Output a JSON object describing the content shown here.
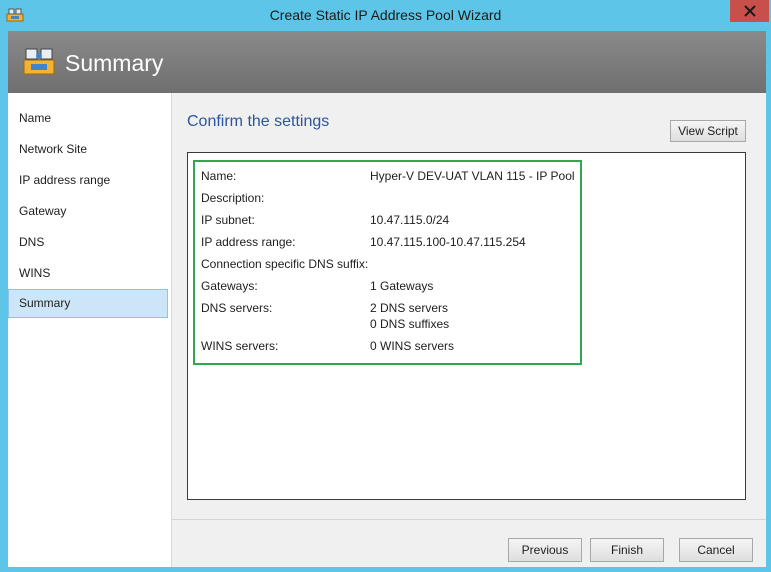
{
  "window": {
    "title": "Create Static IP Address Pool Wizard"
  },
  "header": {
    "title": "Summary"
  },
  "nav": {
    "items": [
      {
        "label": "Name"
      },
      {
        "label": "Network Site"
      },
      {
        "label": "IP address range"
      },
      {
        "label": "Gateway"
      },
      {
        "label": "DNS"
      },
      {
        "label": "WINS"
      },
      {
        "label": "Summary",
        "selected": true
      }
    ]
  },
  "main": {
    "heading": "Confirm the settings",
    "view_script_label": "View Script",
    "settings": [
      {
        "label": "Name:",
        "value": "Hyper-V DEV-UAT VLAN 115 - IP Pool"
      },
      {
        "label": "Description:",
        "value": ""
      },
      {
        "label": "IP subnet:",
        "value": "10.47.115.0/24"
      },
      {
        "label": "IP address range:",
        "value": "10.47.115.100-10.47.115.254"
      },
      {
        "label": "Connection specific DNS suffix:",
        "value": ""
      },
      {
        "label": "Gateways:",
        "value": "1 Gateways"
      },
      {
        "label": "DNS servers:",
        "value": "2 DNS servers",
        "value2": "0 DNS suffixes"
      },
      {
        "label": "WINS servers:",
        "value": "0 WINS servers"
      }
    ]
  },
  "footer": {
    "previous_label": "Previous",
    "finish_label": "Finish",
    "cancel_label": "Cancel"
  },
  "colors": {
    "title_bar": "#5dc6e8",
    "close_button": "#c7504b",
    "heading_text": "#2a5699",
    "highlight_border": "#2fa84f",
    "selected_nav": "#cde6f7"
  },
  "icons": {
    "app": "network-pool-icon",
    "close": "close-icon",
    "header": "network-pool-icon"
  }
}
